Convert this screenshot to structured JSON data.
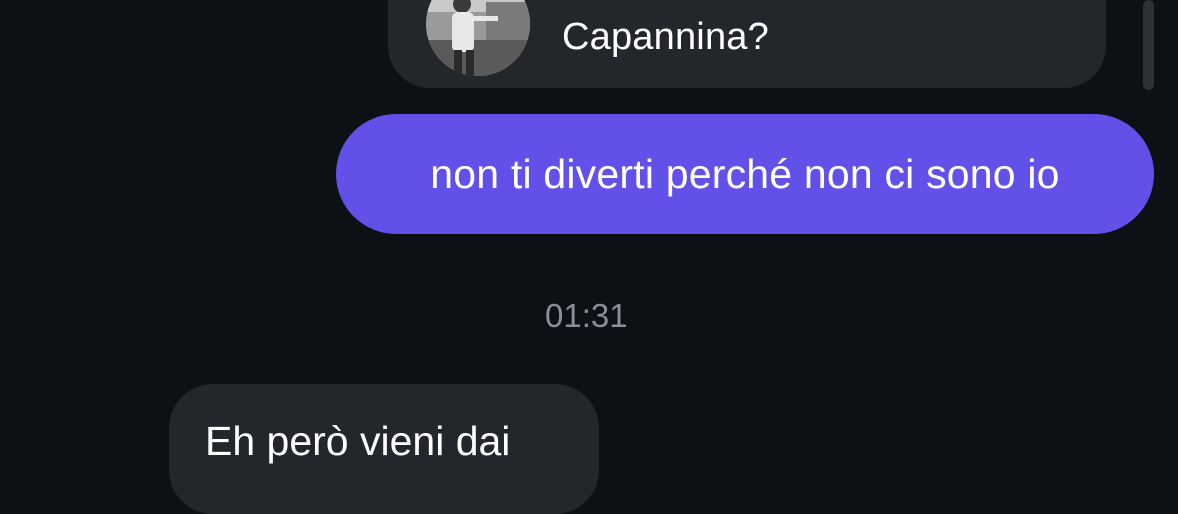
{
  "reply_preview": {
    "text": "Capannina?",
    "avatar": "profile-photo"
  },
  "messages": [
    {
      "direction": "outgoing",
      "text": "non ti diverti perché non ci sono io"
    },
    {
      "direction": "incoming",
      "text": "Eh però vieni dai"
    }
  ],
  "timestamp": "01:31",
  "colors": {
    "background": "#0d1014",
    "bubble_outgoing": "#6251e8",
    "bubble_incoming": "#23262b",
    "timestamp_text": "#8b8f96"
  }
}
